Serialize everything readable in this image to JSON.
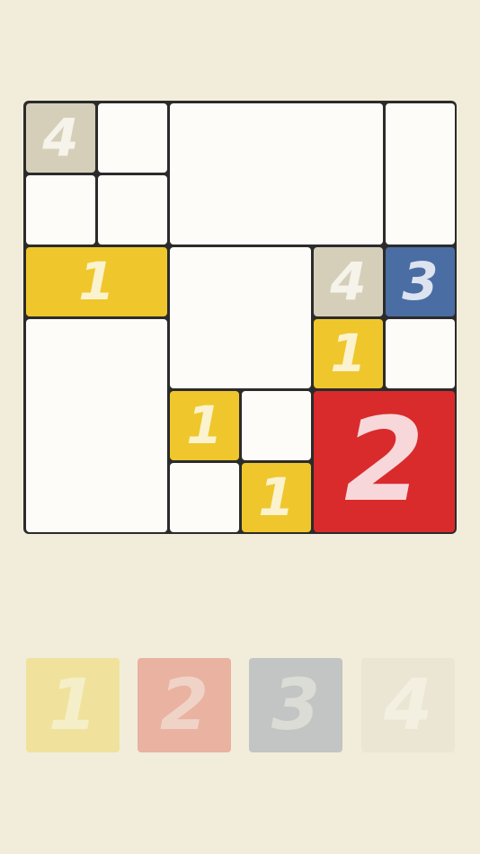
{
  "board": {
    "colors": {
      "grid": "#2b2b2b",
      "empty": "#fdfcf8",
      "tan": "#d5cfba",
      "yellow": "#efc72c",
      "blue": "#4a6da3",
      "red": "#d92b2c"
    },
    "cells": [
      {
        "id": "a1",
        "r": 0,
        "c": 0,
        "rs": 1,
        "cs": 1,
        "value": "4",
        "fill": "tan"
      },
      {
        "id": "b1",
        "r": 0,
        "c": 1,
        "rs": 1,
        "cs": 1,
        "value": "",
        "fill": "empty"
      },
      {
        "id": "c1",
        "r": 0,
        "c": 2,
        "rs": 2,
        "cs": 3,
        "value": "",
        "fill": "empty"
      },
      {
        "id": "f1",
        "r": 0,
        "c": 5,
        "rs": 2,
        "cs": 1,
        "value": "",
        "fill": "empty"
      },
      {
        "id": "a2",
        "r": 1,
        "c": 0,
        "rs": 1,
        "cs": 1,
        "value": "",
        "fill": "empty"
      },
      {
        "id": "b2",
        "r": 1,
        "c": 1,
        "rs": 1,
        "cs": 1,
        "value": "",
        "fill": "empty"
      },
      {
        "id": "a3",
        "r": 2,
        "c": 0,
        "rs": 1,
        "cs": 2,
        "value": "1",
        "fill": "yellow"
      },
      {
        "id": "c3",
        "r": 2,
        "c": 2,
        "rs": 2,
        "cs": 2,
        "value": "",
        "fill": "empty"
      },
      {
        "id": "e3",
        "r": 2,
        "c": 4,
        "rs": 1,
        "cs": 1,
        "value": "4",
        "fill": "tan"
      },
      {
        "id": "f3",
        "r": 2,
        "c": 5,
        "rs": 1,
        "cs": 1,
        "value": "3",
        "fill": "blue"
      },
      {
        "id": "a4",
        "r": 3,
        "c": 0,
        "rs": 3,
        "cs": 2,
        "value": "",
        "fill": "empty"
      },
      {
        "id": "e4",
        "r": 3,
        "c": 4,
        "rs": 1,
        "cs": 1,
        "value": "1",
        "fill": "yellow"
      },
      {
        "id": "f4",
        "r": 3,
        "c": 5,
        "rs": 1,
        "cs": 1,
        "value": "",
        "fill": "empty"
      },
      {
        "id": "c5",
        "r": 4,
        "c": 2,
        "rs": 1,
        "cs": 1,
        "value": "1",
        "fill": "yellow"
      },
      {
        "id": "d5",
        "r": 4,
        "c": 3,
        "rs": 1,
        "cs": 1,
        "value": "",
        "fill": "empty"
      },
      {
        "id": "e5",
        "r": 4,
        "c": 4,
        "rs": 2,
        "cs": 2,
        "value": "2",
        "fill": "red"
      },
      {
        "id": "c6",
        "r": 5,
        "c": 2,
        "rs": 1,
        "cs": 1,
        "value": "",
        "fill": "empty"
      },
      {
        "id": "d6",
        "r": 5,
        "c": 3,
        "rs": 1,
        "cs": 1,
        "value": "1",
        "fill": "yellow"
      }
    ]
  },
  "palette": [
    {
      "value": "1",
      "name": "palette-tile-1",
      "bg": "#f0e29c",
      "fg": "#f5efc9"
    },
    {
      "value": "2",
      "name": "palette-tile-2",
      "bg": "#e9b2a1",
      "fg": "#f0d3c7"
    },
    {
      "value": "3",
      "name": "palette-tile-3",
      "bg": "#c2c5c3",
      "fg": "#dcdcd6"
    },
    {
      "value": "4",
      "name": "palette-tile-4",
      "bg": "#ebe6d3",
      "fg": "#f3f0e2"
    }
  ]
}
